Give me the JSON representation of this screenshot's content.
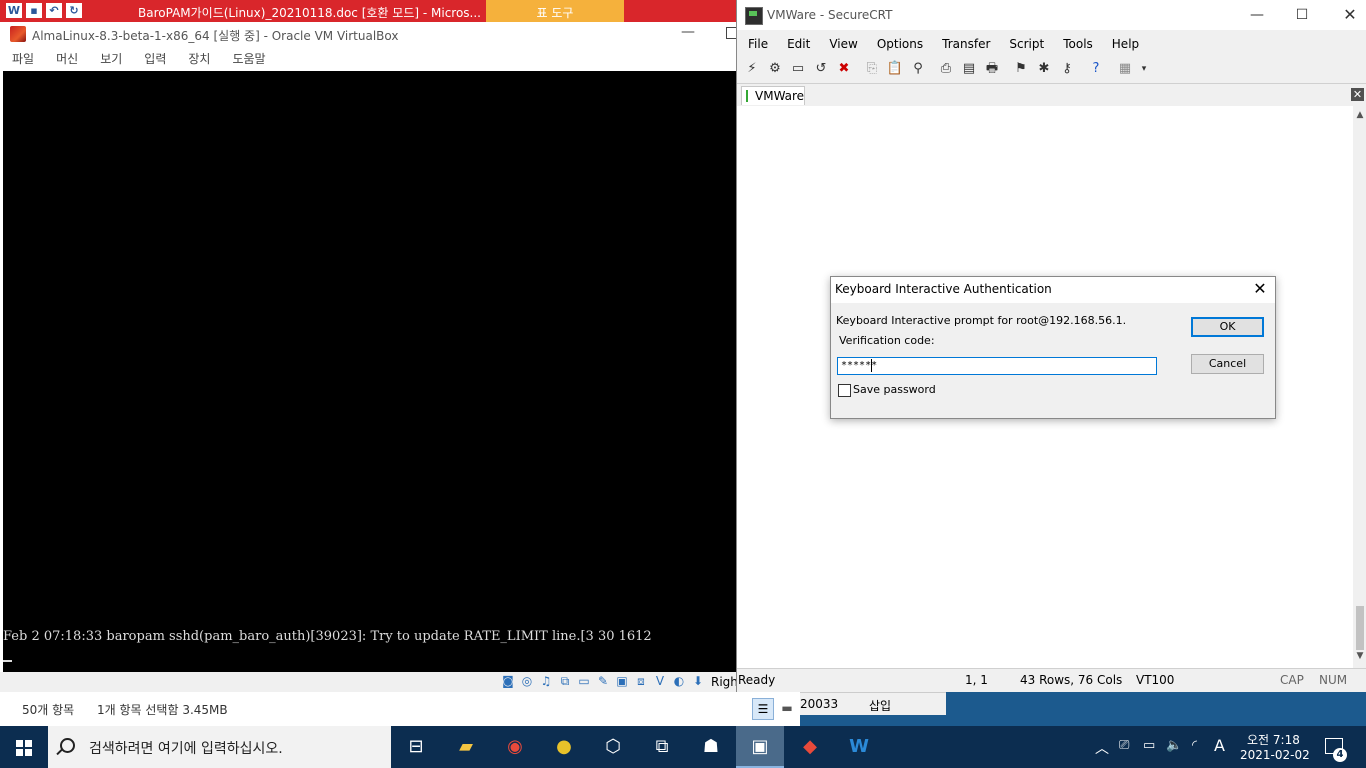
{
  "word": {
    "title": "BaroPAM가이드(Linux)_20210118.doc [호환 모드] - Micros...",
    "tools_tab": "표 도구"
  },
  "vbox": {
    "title": "AlmaLinux-8.3-beta-1-x86_64 [실행 중] - Oracle VM VirtualBox",
    "menu": [
      "파일",
      "머신",
      "보기",
      "입력",
      "장치",
      "도움말"
    ],
    "console_line": "Feb  2 07:18:33 baropam sshd(pam_baro_auth)[39023]: Try to update RATE_LIMIT line.[3 30 1612",
    "host_key": "Right Ctrl"
  },
  "explorer": {
    "item_count": "50개 항목",
    "selection": "1개 항목 선택함 3.45MB"
  },
  "word_status": {
    "number": "20033",
    "mode": "삽입"
  },
  "crt": {
    "title": "VMWare - SecureCRT",
    "menu": [
      "File",
      "Edit",
      "View",
      "Options",
      "Transfer",
      "Script",
      "Tools",
      "Help"
    ],
    "tab_label": "VMWare",
    "status": {
      "ready": "Ready",
      "position": "1,   1",
      "dimensions": "43 Rows,  76 Cols",
      "emulation": "VT100",
      "cap": "CAP",
      "num": "NUM"
    }
  },
  "dialog": {
    "title": "Keyboard Interactive Authentication",
    "prompt": "Keyboard Interactive prompt for root@192.168.56.1.",
    "code_label": "Verification code:",
    "code_value": "******",
    "save_password_label": "Save password",
    "save_password_checked": false,
    "ok_label": "OK",
    "cancel_label": "Cancel"
  },
  "taskbar": {
    "search_placeholder": "검색하려면 여기에 입력하십시오.",
    "clock_time": "오전 7:18",
    "clock_date": "2021-02-02",
    "notification_count": "4",
    "ime_indicator": "A"
  },
  "colors": {
    "word_red": "#d9262b",
    "word_tools_orange": "#f5b13c",
    "taskbar": "#0c2d50",
    "accent_blue": "#0078d7"
  }
}
